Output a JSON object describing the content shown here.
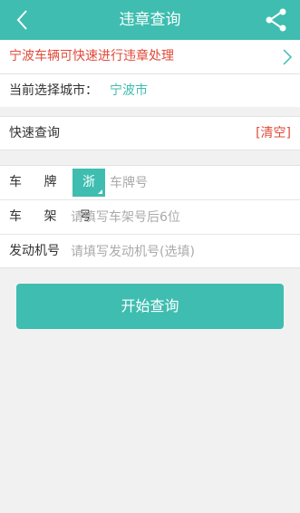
{
  "header": {
    "title": "违章查询",
    "back_icon": "back-chevron-icon",
    "share_icon": "share-icon"
  },
  "promo": {
    "text": "宁波车辆可快速进行违章处理"
  },
  "city": {
    "label": "当前选择城市：",
    "value": "宁波市"
  },
  "quick": {
    "label": "快速查询",
    "clear": "[清空]"
  },
  "form": {
    "plate_label": "车 牌 号",
    "province": "浙",
    "plate_placeholder": "车牌号",
    "frame_label": "车 架 号",
    "frame_placeholder": "请填写车架号后6位",
    "engine_label": "发动机号",
    "engine_placeholder": "请填写发动机号(选填)"
  },
  "start_button": "开始查询",
  "colors": {
    "accent": "#3ebdb0",
    "alert": "#e04a3a"
  }
}
